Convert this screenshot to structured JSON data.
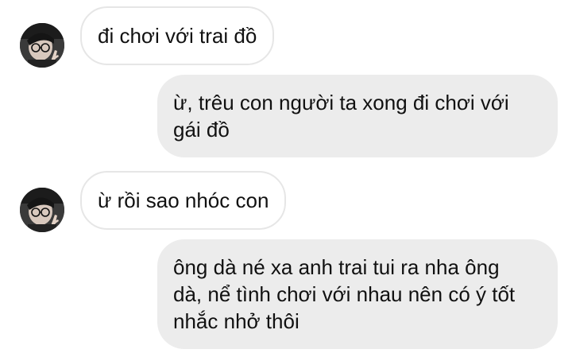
{
  "conversation": {
    "messages": [
      {
        "direction": "incoming",
        "avatar_icon": "avatar-photo",
        "text": "đi chơi với trai đồ"
      },
      {
        "direction": "outgoing",
        "lines": [
          "ừ, trêu con người ta xong đi chơi với",
          "gái đồ"
        ]
      },
      {
        "direction": "incoming",
        "avatar_icon": "avatar-photo",
        "text": "ừ rồi sao nhóc con"
      },
      {
        "direction": "outgoing",
        "lines": [
          "ông dà né xa anh trai tui ra nha ông",
          "dà, nể tình chơi với nhau nên có ý tốt",
          "nhắc nhở thôi"
        ]
      }
    ]
  },
  "colors": {
    "incoming_bubble_bg": "#ffffff",
    "incoming_bubble_border": "#e6e6e6",
    "outgoing_bubble_bg": "#ececec",
    "text": "#111111"
  }
}
